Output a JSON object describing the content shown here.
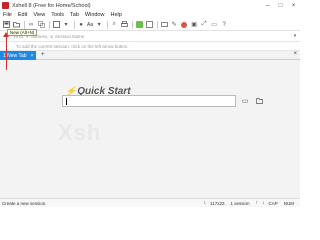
{
  "window": {
    "title": "Xshell 8 (Free for Home/School)",
    "minimize": "–",
    "maximize": "□",
    "close": "×"
  },
  "menu": [
    "File",
    "Edit",
    "View",
    "Tools",
    "Tab",
    "Window",
    "Help"
  ],
  "toolbar": {
    "font_label": "Aa",
    "tooltip": "New (Alt+N)"
  },
  "address": {
    "placeholder": "Host, IP address, or Session Name"
  },
  "hint": {
    "text": "To add the current session, click on the left arrow button."
  },
  "tabs": [
    {
      "label": "1 New Tab",
      "close": "×"
    }
  ],
  "tab_add": "+",
  "tab_close": "×",
  "quick_start": {
    "title": "Quick Start"
  },
  "status": {
    "left": "Create a new session.",
    "size": "117x23",
    "sessions": "1 session",
    "caps": "CAP",
    "num": "NUM"
  },
  "colors": {
    "accent": "#1e88e5",
    "arrow": "#d32f2f"
  },
  "icons": [
    "new-session-icon",
    "open-icon",
    "link-icon",
    "copy-icon",
    "globe-icon",
    "font-icon",
    "search-icon",
    "print-icon",
    "transfer-icon",
    "keyboard-icon",
    "record-icon",
    "lock-icon",
    "help-icon"
  ]
}
